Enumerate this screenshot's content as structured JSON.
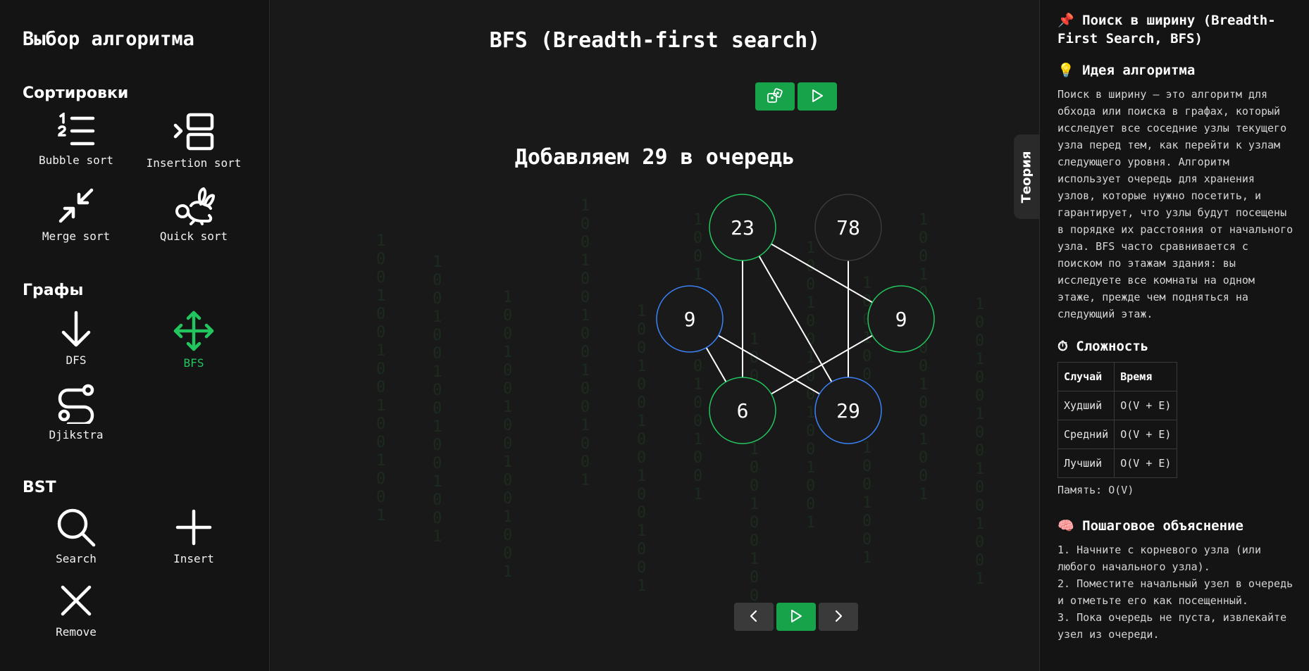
{
  "sidebar": {
    "title": "Выбор алгоритма",
    "sections": {
      "sorting": "Сортировки",
      "graphs": "Графы",
      "bst": "BST"
    },
    "items": {
      "bubble": "Bubble sort",
      "insertion": "Insertion sort",
      "merge": "Merge sort",
      "quick": "Quick sort",
      "dfs": "DFS",
      "bfs": "BFS",
      "dijkstra": "Djikstra",
      "search": "Search",
      "insert": "Insert",
      "remove": "Remove"
    },
    "active_item": "BFS"
  },
  "main": {
    "title": "BFS (Breadth-first search)",
    "step_message": "Добавляем 29 в очередь",
    "theory_tab": "Теория"
  },
  "graph": {
    "nodes": [
      {
        "id": "a",
        "label": "23",
        "state": "visited"
      },
      {
        "id": "b",
        "label": "78",
        "state": "default"
      },
      {
        "id": "c",
        "label": "9",
        "state": "queued"
      },
      {
        "id": "d",
        "label": "9",
        "state": "visited"
      },
      {
        "id": "e",
        "label": "6",
        "state": "visited"
      },
      {
        "id": "f",
        "label": "29",
        "state": "queued"
      }
    ],
    "edges": [
      [
        "a",
        "e"
      ],
      [
        "a",
        "d"
      ],
      [
        "a",
        "f"
      ],
      [
        "b",
        "f"
      ],
      [
        "c",
        "e"
      ],
      [
        "c",
        "f"
      ],
      [
        "d",
        "e"
      ]
    ],
    "colors": {
      "visited": "#22c55e",
      "queued": "#3b82f6",
      "default": "#3a3a3a",
      "edge": "#ffffff",
      "node_fill": "#1a1a1a"
    }
  },
  "panel": {
    "title_icon": "📌",
    "title": "Поиск в ширину (Breadth-First Search, BFS)",
    "idea_icon": "💡",
    "idea_heading": "Идея алгоритма",
    "idea_text": "Поиск в ширину — это алгоритм для обхода или поиска в графах, который исследует все соседние узлы текущего узла перед тем, как перейти к узлам следующего уровня. Алгоритм использует очередь для хранения узлов, которые нужно посетить, и гарантирует, что узлы будут посещены в порядке их расстояния от начального узла. BFS часто сравнивается с поиском по этажам здания: вы исследуете все комнаты на одном этаже, прежде чем подняться на следующий этаж.",
    "complexity_icon": "⏱",
    "complexity_heading": "Сложность",
    "table": {
      "headers": [
        "Случай",
        "Время"
      ],
      "rows": [
        [
          "Худший",
          "O(V + E)"
        ],
        [
          "Средний",
          "O(V + E)"
        ],
        [
          "Лучший",
          "O(V + E)"
        ]
      ]
    },
    "memory": "Память: O(V)",
    "steps_icon": "🧠",
    "steps_heading": "Пошаговое объяснение",
    "steps": [
      "1. Начните с корневого узла (или любого начального узла).",
      "2. Поместите начальный узел в очередь и отметьте его как посещенный.",
      "3. Пока очередь не пуста, извлекайте узел из очереди."
    ]
  }
}
